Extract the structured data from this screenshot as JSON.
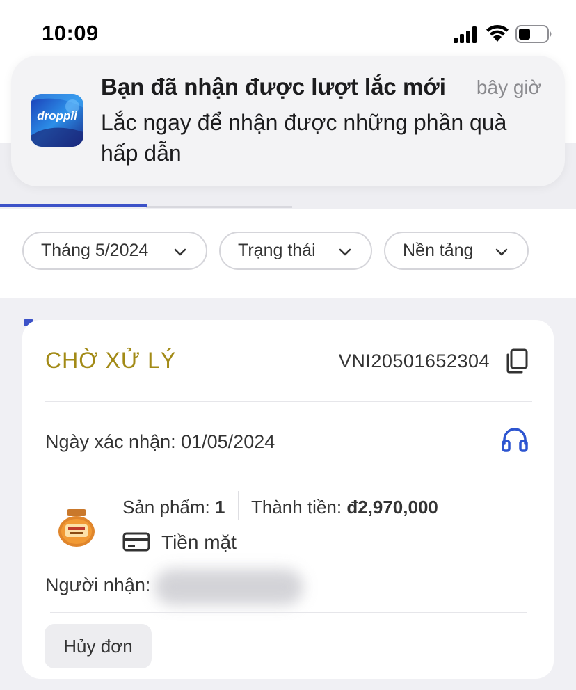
{
  "statusbar": {
    "time": "10:09"
  },
  "notification": {
    "app_icon_text": "droppii",
    "title": "Bạn đã nhận được lượt lắc mới",
    "time": "bây giờ",
    "body": "Lắc ngay để nhận được những phần quà hấp dẫn"
  },
  "filters": [
    {
      "label": "Tháng 5/2024"
    },
    {
      "label": "Trạng thái"
    },
    {
      "label": "Nền tảng"
    }
  ],
  "order": {
    "status": "CHỜ XỬ LÝ",
    "status_color": "#a28a16",
    "order_id": "VNI20501652304",
    "date": "Ngày xác nhận: 01/05/2024",
    "qty_label": "Sản phẩm: ",
    "qty_value": "1",
    "total_label": "Thành tiền: ",
    "total_value": "đ2,970,000",
    "payment_method": "Tiền mặt",
    "recipient_label": "Người nhận:",
    "cancel_label": "Hủy đơn"
  },
  "colors": {
    "accent": "#3c52c8",
    "headset": "#2d55d0"
  }
}
